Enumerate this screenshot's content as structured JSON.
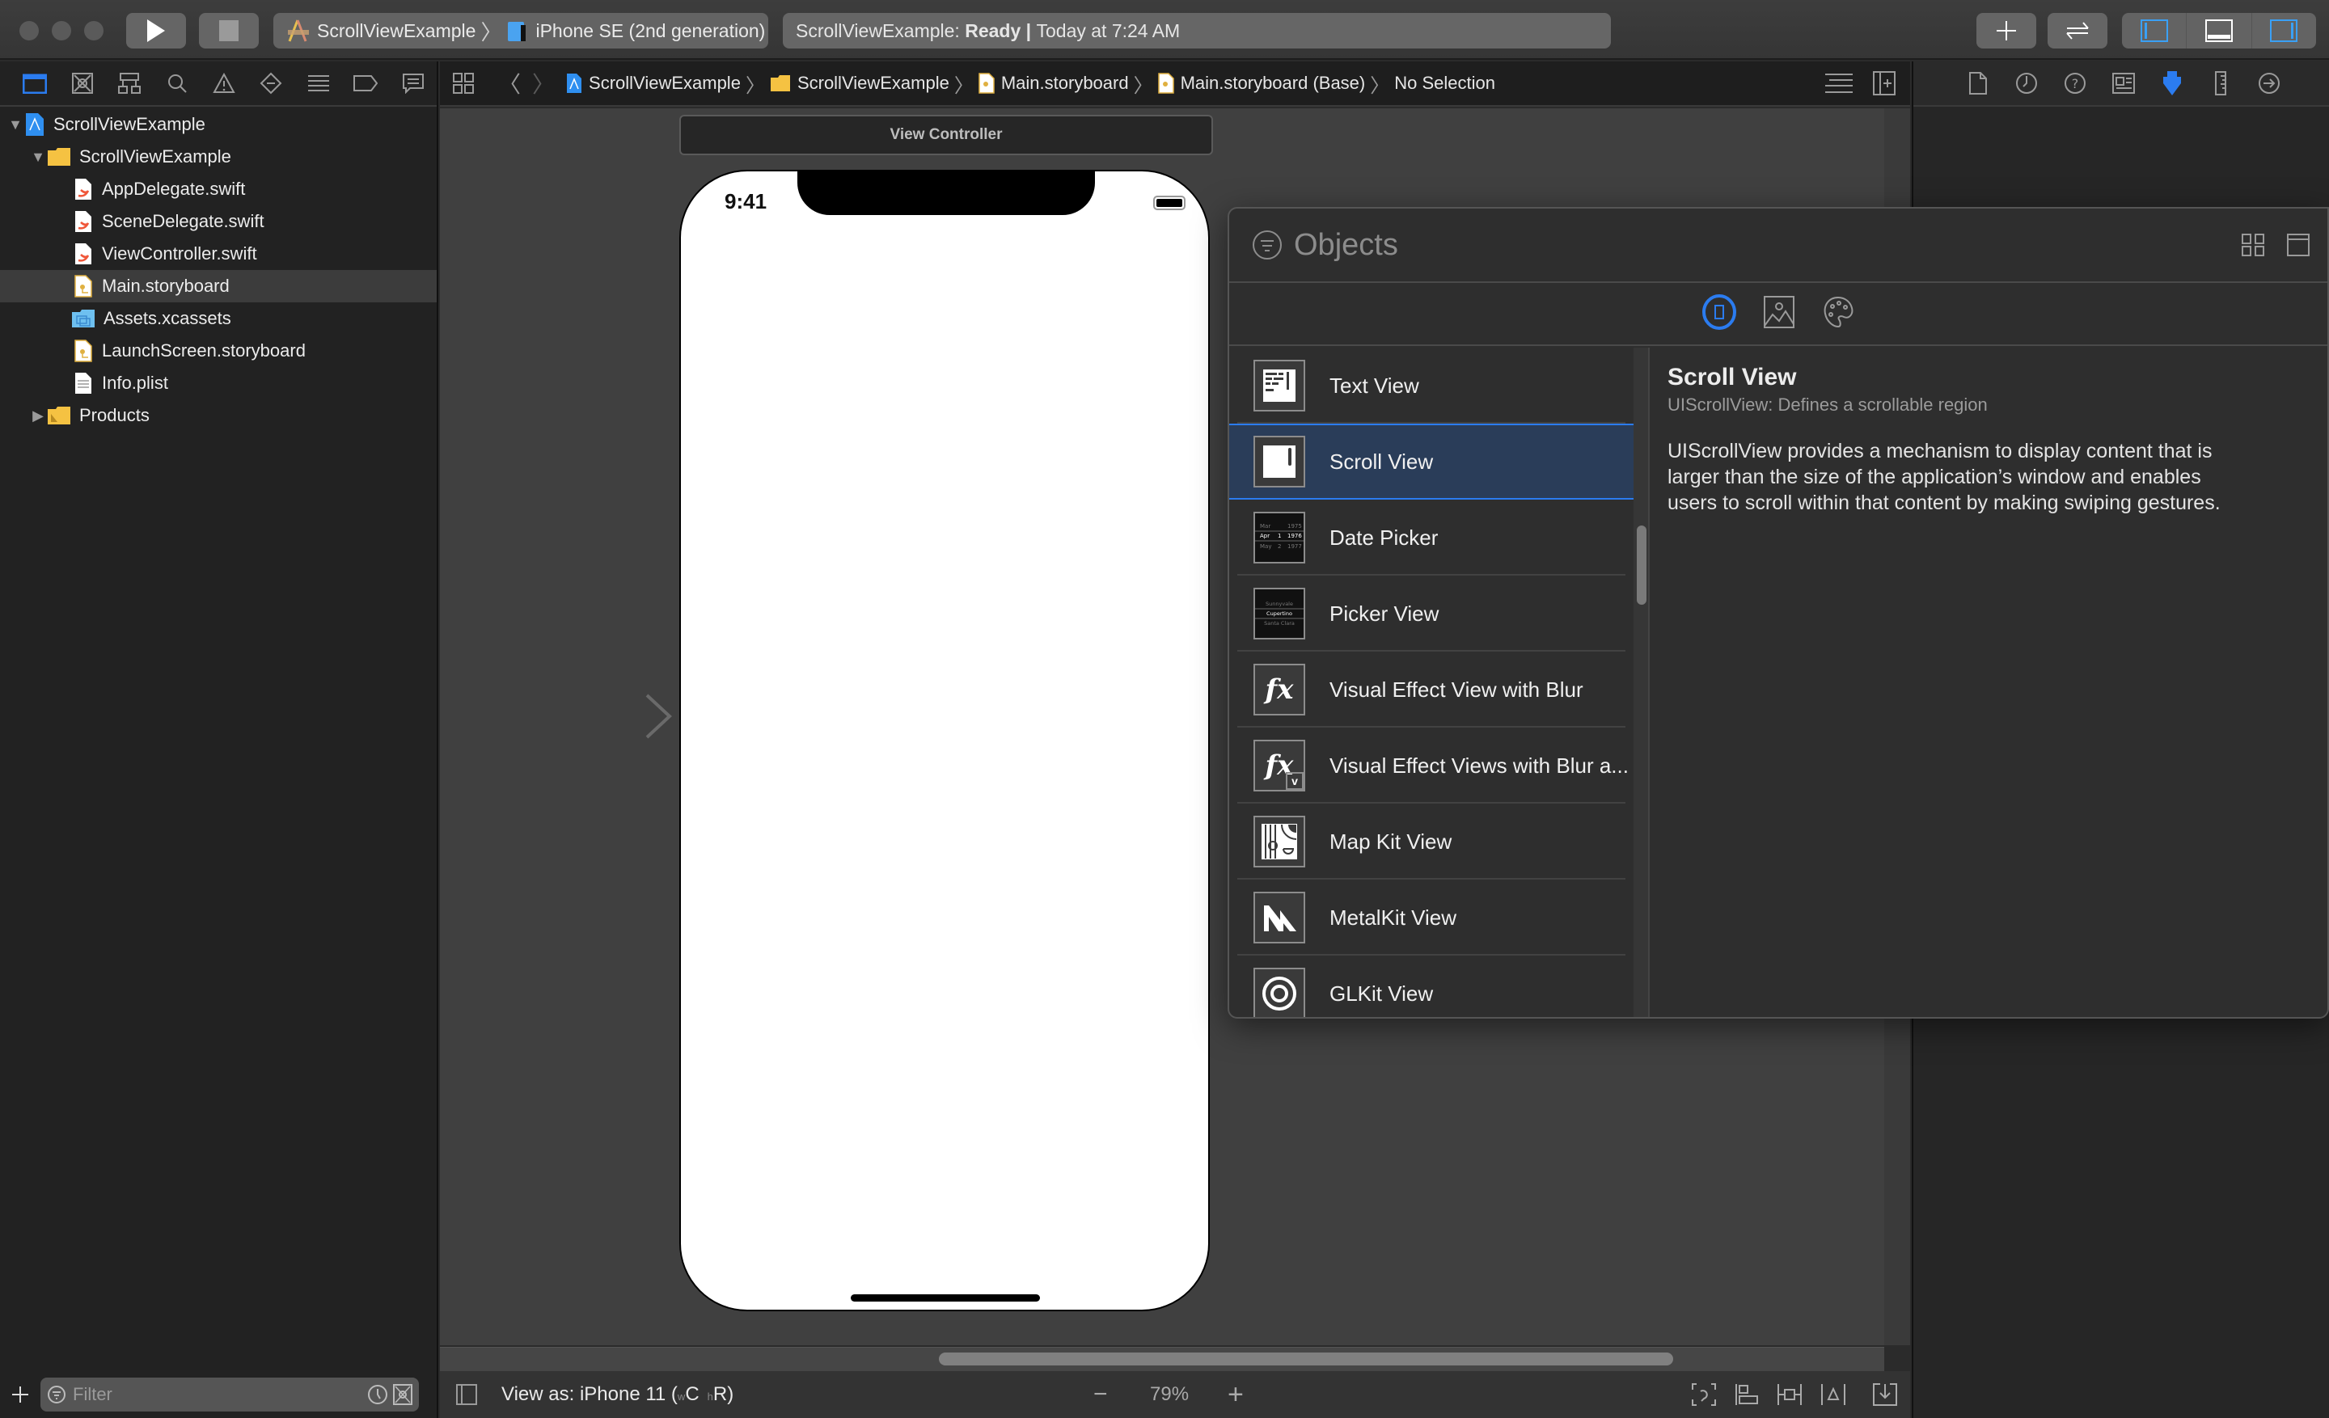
{
  "toolbar": {
    "scheme_name": "ScrollViewExample",
    "destination": "iPhone SE (2nd generation)",
    "status_project": "ScrollViewExample:",
    "status_state": "Ready",
    "status_separator": "|",
    "status_time": "Today at 7:24 AM",
    "run_icon": "play-icon",
    "stop_icon": "stop-icon",
    "library_icon": "plus-icon",
    "review_icon": "swap-arrows-icon",
    "panel_toggles": [
      "navigator-panel-icon",
      "debug-area-icon",
      "inspector-panel-icon"
    ]
  },
  "navigator": {
    "tabs": [
      "project-navigator-icon",
      "source-control-icon",
      "symbol-navigator-icon",
      "find-icon",
      "issue-icon",
      "test-icon",
      "debug-icon",
      "breakpoint-icon",
      "report-icon"
    ],
    "tree": [
      {
        "label": "ScrollViewExample",
        "type": "project",
        "depth": 0,
        "expanded": true
      },
      {
        "label": "ScrollViewExample",
        "type": "folder",
        "depth": 1,
        "expanded": true
      },
      {
        "label": "AppDelegate.swift",
        "type": "swift",
        "depth": 2
      },
      {
        "label": "SceneDelegate.swift",
        "type": "swift",
        "depth": 2
      },
      {
        "label": "ViewController.swift",
        "type": "swift",
        "depth": 2
      },
      {
        "label": "Main.storyboard",
        "type": "storyboard",
        "depth": 2,
        "selected": true
      },
      {
        "label": "Assets.xcassets",
        "type": "assets",
        "depth": 2
      },
      {
        "label": "LaunchScreen.storyboard",
        "type": "storyboard",
        "depth": 2
      },
      {
        "label": "Info.plist",
        "type": "plist",
        "depth": 2
      },
      {
        "label": "Products",
        "type": "folder",
        "depth": 1,
        "expanded": false
      }
    ],
    "filter_placeholder": "Filter"
  },
  "jumpbar": {
    "crumbs": [
      "ScrollViewExample",
      "ScrollViewExample",
      "Main.storyboard",
      "Main.storyboard (Base)",
      "No Selection"
    ]
  },
  "canvas": {
    "scene_title": "View Controller",
    "status_time": "9:41",
    "view_as": "View as: iPhone 11 (",
    "size_w": "w",
    "size_w_val": "C",
    "size_h": "h",
    "size_h_val": "R)",
    "zoom": "79%",
    "zoom_out": "−",
    "zoom_in": "+"
  },
  "library": {
    "search_placeholder": "Objects",
    "filter_tabs": [
      "objects-icon",
      "media-icon",
      "color-icon"
    ],
    "items": [
      {
        "label": "Text View",
        "icon": "text-view-icon"
      },
      {
        "label": "Scroll View",
        "icon": "scroll-view-icon",
        "selected": true
      },
      {
        "label": "Date Picker",
        "icon": "date-picker-icon"
      },
      {
        "label": "Picker View",
        "icon": "picker-view-icon"
      },
      {
        "label": "Visual Effect View with Blur",
        "icon": "visual-effect-icon"
      },
      {
        "label": "Visual Effect Views with Blur a...",
        "icon": "visual-effect-vibrancy-icon"
      },
      {
        "label": "Map Kit View",
        "icon": "map-kit-icon"
      },
      {
        "label": "MetalKit View",
        "icon": "metalkit-icon"
      },
      {
        "label": "GLKit View",
        "icon": "glkit-icon"
      }
    ],
    "detail": {
      "title": "Scroll View",
      "subtitle": "UIScrollView: Defines a scrollable region",
      "description": "UIScrollView provides a mechanism to display content that is larger than the size of the application’s window and enables users to scroll within that content by making swiping gestures."
    },
    "date_picker_thumb": {
      "months": [
        "Mar",
        "Apr",
        "May"
      ],
      "days": [
        "",
        "1",
        "2"
      ],
      "years": [
        "1975",
        "1976",
        "1977"
      ]
    },
    "picker_thumb": [
      "Sunnyvale",
      "Cupertino",
      "Santa Clara"
    ]
  },
  "inspector": {
    "tabs": [
      "file-inspector-icon",
      "history-icon",
      "quick-help-icon",
      "identity-inspector-icon",
      "attributes-inspector-icon",
      "size-inspector-icon",
      "connections-inspector-icon"
    ]
  },
  "colors": {
    "accent": "#2b7cf0",
    "selection": "#2a3d59",
    "folder": "#f5c242"
  }
}
